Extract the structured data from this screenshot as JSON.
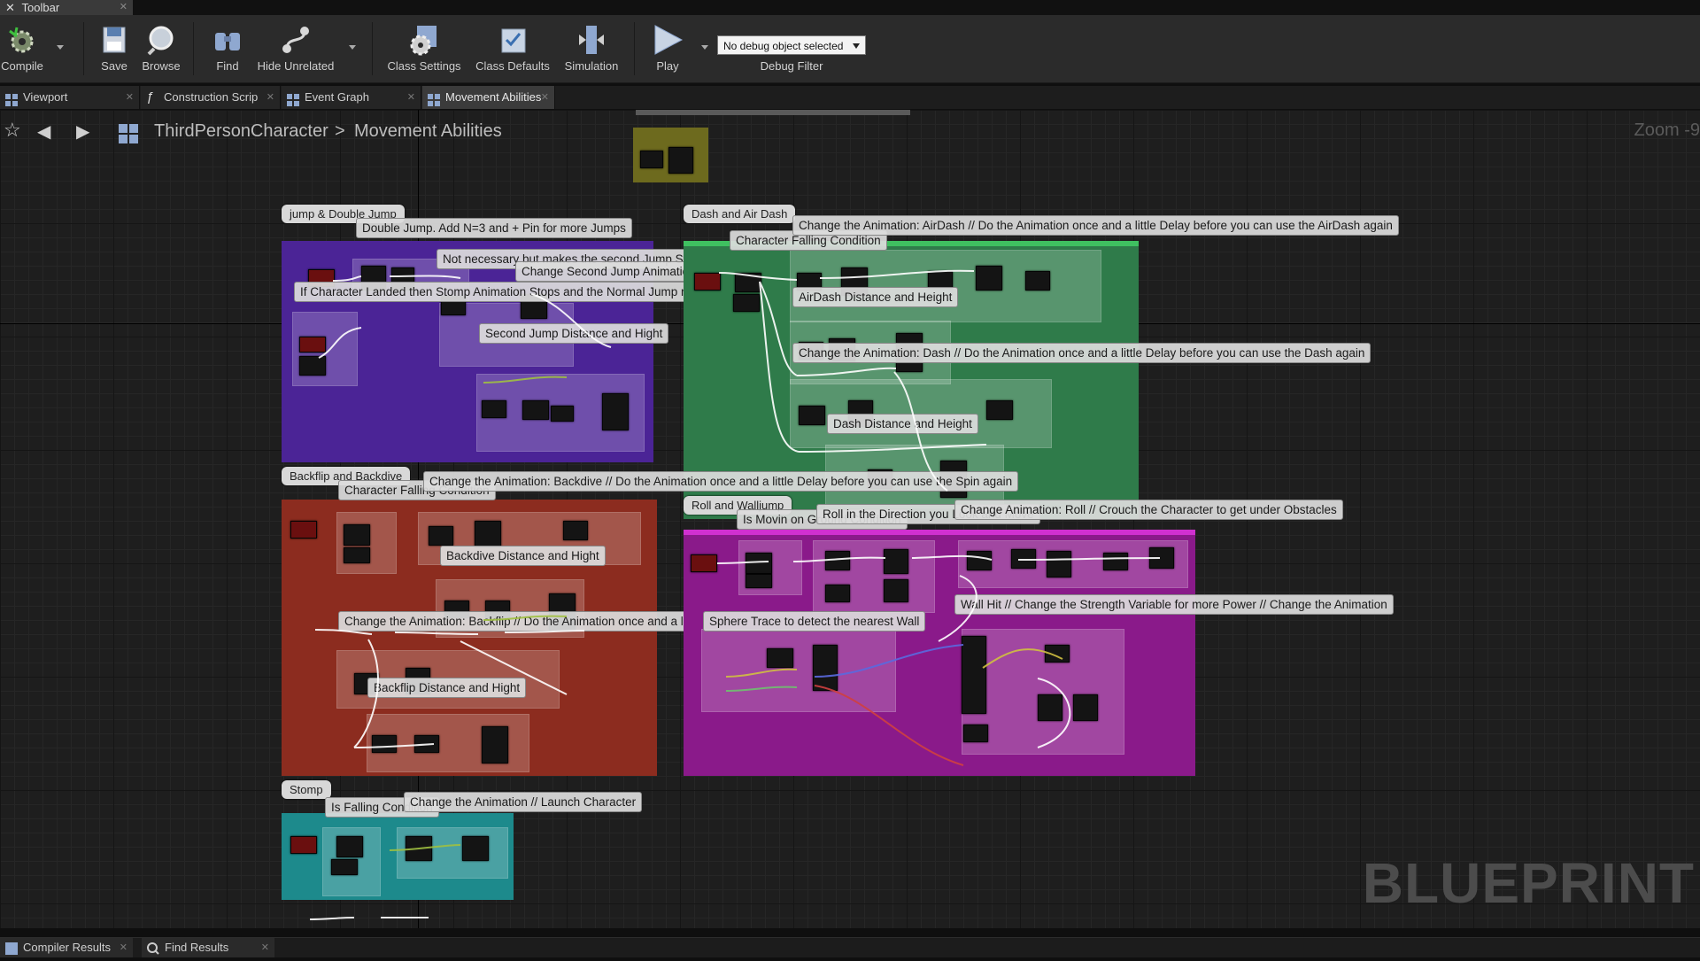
{
  "window": {
    "tab_title": "Toolbar"
  },
  "toolbar": {
    "compile": "Compile",
    "save": "Save",
    "browse": "Browse",
    "find": "Find",
    "hide_unrelated": "Hide Unrelated",
    "class_settings": "Class Settings",
    "class_defaults": "Class Defaults",
    "simulation": "Simulation",
    "play": "Play",
    "debug_object": "No debug object selected",
    "debug_filter": "Debug Filter"
  },
  "tabs": [
    {
      "label": "Viewport"
    },
    {
      "label": "Construction Scrip"
    },
    {
      "label": "Event Graph"
    },
    {
      "label": "Movement Abilities"
    }
  ],
  "breadcrumb": {
    "root": "ThirdPersonCharacter",
    "separator": ">",
    "current": "Movement Abilities"
  },
  "zoom": "Zoom -9",
  "watermark": "BLUEPRINT",
  "groups": {
    "jump": "jump & Double Jump",
    "dash": "Dash and Air Dash",
    "backflip": "Backflip and Backdive",
    "roll": "Roll and Walljump",
    "stomp": "Stomp"
  },
  "comments": {
    "double_jump": "Double Jump. Add N=3 and + Pin for more Jumps",
    "not_necessary": "Not necessary but makes the second Jump Start sharper",
    "change_second_jump": "Change Second Jump Animation",
    "landed_stomp": "If Character Landed then Stomp Animation Stops and the Normal Jump resets",
    "second_jump_distance": "Second Jump Distance and Hight",
    "char_falling_dash": "Character Falling Condition",
    "airdash_anim": "Change the Animation: AirDash // Do the Animation once and a little Delay before you can use the AirDash again",
    "airdash_distance": "AirDash Distance and Height",
    "dash_anim": "Change the Animation: Dash // Do the Animation once and a little Delay before you can use the Dash again",
    "dash_distance": "Dash Distance and Height",
    "char_falling_backflip": "Character Falling Condition",
    "backdive_anim": "Change the Animation: Backdive // Do the Animation once and a little Delay before you can use the Spin again",
    "backdive_distance": "Backdive Distance and Hight",
    "backflip_anim": "Change the Animation: Backflip // Do the Animation once and a little Delay before you can use the Spin again",
    "backflip_distance": "Backflip Distance and Hight",
    "moving_ground": "Is Movin on Ground Condition",
    "roll_direction": "Roll in the Direction you Look and Move",
    "roll_anim": "Change Animation: Roll // Crouch the Character to get under Obstacles",
    "wall_hit": "Wall Hit // Change the Strength Variable for more Power // Change the Animation",
    "sphere_trace": "Sphere Trace to detect the nearest Wall",
    "is_falling": "Is Falling Condition",
    "launch": "Change the Animation // Launch Character"
  },
  "bottom_tabs": [
    {
      "label": "Compiler Results"
    },
    {
      "label": "Find Results"
    }
  ],
  "colors": {
    "jump_group": "#4b2496",
    "dash_group": "#2f7b4a",
    "backflip_group": "#8c2c1f",
    "roll_group": "#8a1a8a",
    "stomp_group": "#1d8a8c",
    "toolbar_bg": "#2b2b2b",
    "graph_bg": "#1e1e1e"
  }
}
